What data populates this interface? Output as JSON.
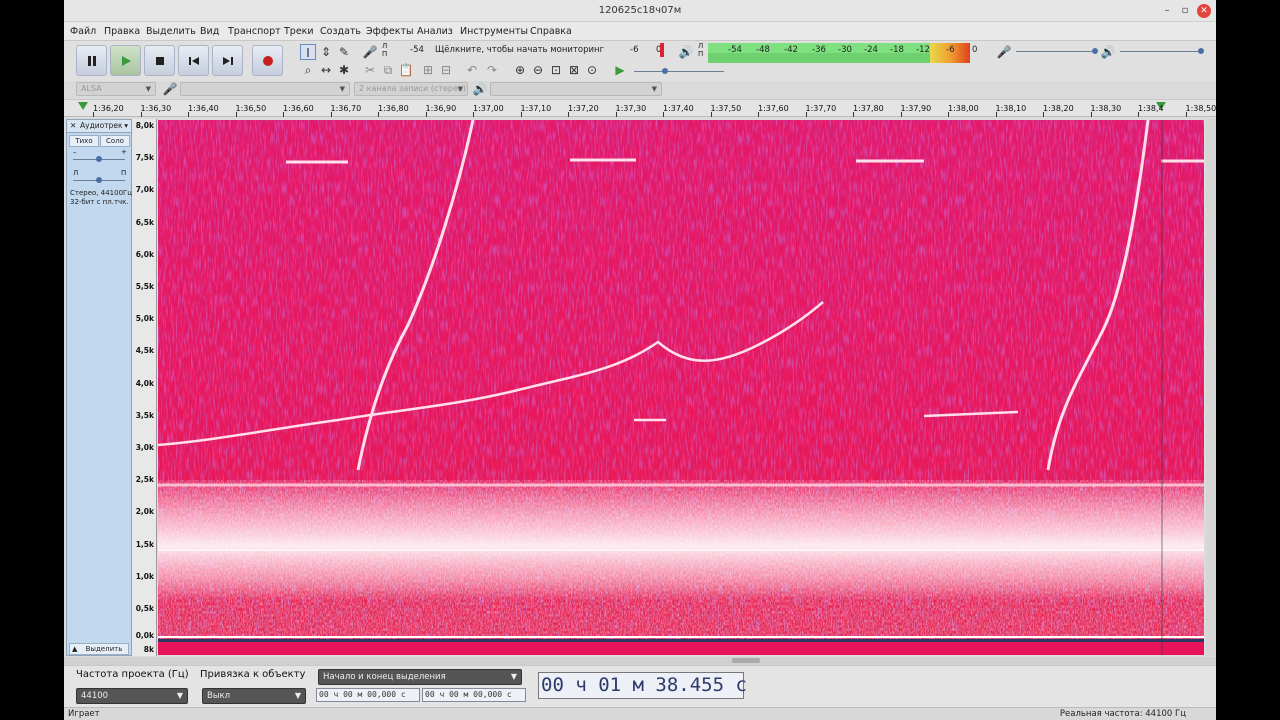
{
  "window": {
    "title": "120625c18ч07м"
  },
  "menu": [
    "Файл",
    "Правка",
    "Выделить",
    "Вид",
    "Транспорт",
    "Треки",
    "Создать",
    "Эффекты",
    "Анализ",
    "Инструменты",
    "Справка"
  ],
  "colors": {
    "spectrogram_bg": "#e8145a",
    "meter_green": "#7ee07e",
    "accent": "#4a6fa5"
  },
  "transport": {
    "pause": "pause-icon",
    "play": "play-icon",
    "stop": "stop-icon",
    "skip_start": "skip-start-icon",
    "skip_end": "skip-end-icon",
    "record": "record-icon"
  },
  "meters": {
    "record_channels": "Л\nП",
    "monitor_hint": "Щёлкните, чтобы начать мониторинг",
    "record_ticks": [
      "-54",
      "-6",
      "0"
    ],
    "play_ticks": [
      "-54",
      "-48",
      "-42",
      "-36",
      "-30",
      "-24",
      "-18",
      "-12",
      "-6",
      "0"
    ]
  },
  "device": {
    "host": "ALSA",
    "channels": "2 канала записи (стерео)"
  },
  "ruler": {
    "ticks": [
      "1:36,20",
      "1:36,30",
      "1:36,40",
      "1:36,50",
      "1:36,60",
      "1:36,70",
      "1:36,80",
      "1:36,90",
      "1:37,00",
      "1:37,10",
      "1:37,20",
      "1:37,30",
      "1:37,40",
      "1:37,50",
      "1:37,60",
      "1:37,70",
      "1:37,80",
      "1:37,90",
      "1:38,00",
      "1:38,10",
      "1:38,20",
      "1:38,30",
      "1:38,4",
      "1:38,50"
    ]
  },
  "track": {
    "name": "Аудиотрек",
    "mute": "Тихо",
    "solo": "Соло",
    "gain_minus": "–",
    "gain_plus": "+",
    "pan_left": "Л",
    "pan_right": "П",
    "info_line1": "Стерео, 44100Гц",
    "info_line2": "32-бит с пл.тчк.",
    "select": "Выделить",
    "freq_labels": [
      "8,0k",
      "7,5k",
      "7,0k",
      "6,5k",
      "6,0k",
      "5,5k",
      "5,0k",
      "4,5k",
      "4,0k",
      "3,5k",
      "3,0k",
      "2,5k",
      "2,0k",
      "1,5k",
      "1,0k",
      "0,5k",
      "0,0k",
      "8k"
    ]
  },
  "selection": {
    "project_rate_label": "Частота проекта (Гц)",
    "project_rate": "44100",
    "snap_label": "Привязка к объекту",
    "snap_value": "Выкл",
    "mode": "Начало и конец выделения",
    "start": "00 ч 00 м 00,000 с",
    "end": "00 ч 00 м 00,000 с",
    "position": "00 ч 01 м 38.455 с"
  },
  "status": {
    "left": "Играет",
    "right": "Реальная частота: 44100 Гц"
  }
}
